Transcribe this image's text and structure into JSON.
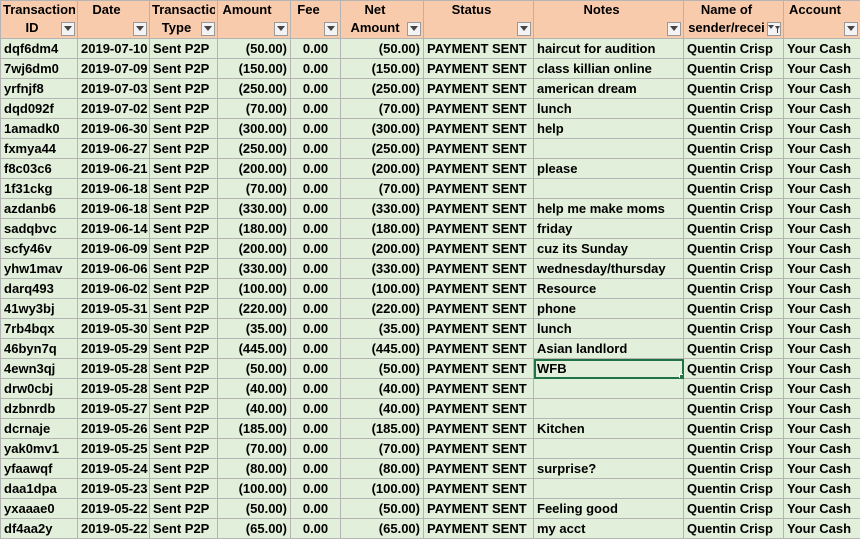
{
  "headers": [
    {
      "label": "Transaction ID",
      "filtered": false
    },
    {
      "label": "Date",
      "filtered": false
    },
    {
      "label": "Transaction Type",
      "filtered": false
    },
    {
      "label": "Amount",
      "filtered": false
    },
    {
      "label": "Fee",
      "filtered": false
    },
    {
      "label": "Net Amount",
      "filtered": false
    },
    {
      "label": "Status",
      "filtered": false
    },
    {
      "label": "Notes",
      "filtered": false
    },
    {
      "label": "Name of sender/recei",
      "filtered": true
    },
    {
      "label": "Account",
      "filtered": false
    }
  ],
  "rows": [
    [
      "dqf6dm4",
      "2019-07-10",
      "Sent P2P",
      "(50.00)",
      "0.00",
      "(50.00)",
      "PAYMENT SENT",
      "haircut for audition",
      "Quentin Crisp",
      "Your Cash"
    ],
    [
      "7wj6dm0",
      "2019-07-09",
      "Sent P2P",
      "(150.00)",
      "0.00",
      "(150.00)",
      "PAYMENT SENT",
      "class killian online",
      "Quentin Crisp",
      "Your Cash"
    ],
    [
      "yrfnjf8",
      "2019-07-03",
      "Sent P2P",
      "(250.00)",
      "0.00",
      "(250.00)",
      "PAYMENT SENT",
      "american dream",
      "Quentin Crisp",
      "Your Cash"
    ],
    [
      "dqd092f",
      "2019-07-02",
      "Sent P2P",
      "(70.00)",
      "0.00",
      "(70.00)",
      "PAYMENT SENT",
      "lunch",
      "Quentin Crisp",
      "Your Cash"
    ],
    [
      "1amadk0",
      "2019-06-30",
      "Sent P2P",
      "(300.00)",
      "0.00",
      "(300.00)",
      "PAYMENT SENT",
      "help",
      "Quentin Crisp",
      "Your Cash"
    ],
    [
      "fxmya44",
      "2019-06-27",
      "Sent P2P",
      "(250.00)",
      "0.00",
      "(250.00)",
      "PAYMENT SENT",
      "",
      "Quentin Crisp",
      "Your Cash"
    ],
    [
      "f8c03c6",
      "2019-06-21",
      "Sent P2P",
      "(200.00)",
      "0.00",
      "(200.00)",
      "PAYMENT SENT",
      "please",
      "Quentin Crisp",
      "Your Cash"
    ],
    [
      "1f31ckg",
      "2019-06-18",
      "Sent P2P",
      "(70.00)",
      "0.00",
      "(70.00)",
      "PAYMENT SENT",
      "",
      "Quentin Crisp",
      "Your Cash"
    ],
    [
      "azdanb6",
      "2019-06-18",
      "Sent P2P",
      "(330.00)",
      "0.00",
      "(330.00)",
      "PAYMENT SENT",
      "help me make moms",
      "Quentin Crisp",
      "Your Cash"
    ],
    [
      "sadqbvc",
      "2019-06-14",
      "Sent P2P",
      "(180.00)",
      "0.00",
      "(180.00)",
      "PAYMENT SENT",
      "friday",
      "Quentin Crisp",
      "Your Cash"
    ],
    [
      "scfy46v",
      "2019-06-09",
      "Sent P2P",
      "(200.00)",
      "0.00",
      "(200.00)",
      "PAYMENT SENT",
      "cuz its Sunday",
      "Quentin Crisp",
      "Your Cash"
    ],
    [
      "yhw1mav",
      "2019-06-06",
      "Sent P2P",
      "(330.00)",
      "0.00",
      "(330.00)",
      "PAYMENT SENT",
      "wednesday/thursday",
      "Quentin Crisp",
      "Your Cash"
    ],
    [
      "darq493",
      "2019-06-02",
      "Sent P2P",
      "(100.00)",
      "0.00",
      "(100.00)",
      "PAYMENT SENT",
      "Resource",
      "Quentin Crisp",
      "Your Cash"
    ],
    [
      "41wy3bj",
      "2019-05-31",
      "Sent P2P",
      "(220.00)",
      "0.00",
      "(220.00)",
      "PAYMENT SENT",
      "phone",
      "Quentin Crisp",
      "Your Cash"
    ],
    [
      "7rb4bqx",
      "2019-05-30",
      "Sent P2P",
      "(35.00)",
      "0.00",
      "(35.00)",
      "PAYMENT SENT",
      "lunch",
      "Quentin Crisp",
      "Your Cash"
    ],
    [
      "46byn7q",
      "2019-05-29",
      "Sent P2P",
      "(445.00)",
      "0.00",
      "(445.00)",
      "PAYMENT SENT",
      "Asian landlord",
      "Quentin Crisp",
      "Your Cash"
    ],
    [
      "4ewn3qj",
      "2019-05-28",
      "Sent P2P",
      "(50.00)",
      "0.00",
      "(50.00)",
      "PAYMENT SENT",
      "WFB",
      "Quentin Crisp",
      "Your Cash"
    ],
    [
      "drw0cbj",
      "2019-05-28",
      "Sent P2P",
      "(40.00)",
      "0.00",
      "(40.00)",
      "PAYMENT SENT",
      "",
      "Quentin Crisp",
      "Your Cash"
    ],
    [
      "dzbnrdb",
      "2019-05-27",
      "Sent P2P",
      "(40.00)",
      "0.00",
      "(40.00)",
      "PAYMENT SENT",
      "",
      "Quentin Crisp",
      "Your Cash"
    ],
    [
      "dcrnaje",
      "2019-05-26",
      "Sent P2P",
      "(185.00)",
      "0.00",
      "(185.00)",
      "PAYMENT SENT",
      "Kitchen",
      "Quentin Crisp",
      "Your Cash"
    ],
    [
      "yak0mv1",
      "2019-05-25",
      "Sent P2P",
      "(70.00)",
      "0.00",
      "(70.00)",
      "PAYMENT SENT",
      "",
      "Quentin Crisp",
      "Your Cash"
    ],
    [
      "yfaawqf",
      "2019-05-24",
      "Sent P2P",
      "(80.00)",
      "0.00",
      "(80.00)",
      "PAYMENT SENT",
      "surprise?",
      "Quentin Crisp",
      "Your Cash"
    ],
    [
      "daa1dpa",
      "2019-05-23",
      "Sent P2P",
      "(100.00)",
      "0.00",
      "(100.00)",
      "PAYMENT SENT",
      "",
      "Quentin Crisp",
      "Your Cash"
    ],
    [
      "yxaaae0",
      "2019-05-22",
      "Sent P2P",
      "(50.00)",
      "0.00",
      "(50.00)",
      "PAYMENT SENT",
      "Feeling good",
      "Quentin Crisp",
      "Your Cash"
    ],
    [
      "df4aa2y",
      "2019-05-22",
      "Sent P2P",
      "(65.00)",
      "0.00",
      "(65.00)",
      "PAYMENT SENT",
      "my acct",
      "Quentin Crisp",
      "Your Cash"
    ]
  ],
  "selected_cell": {
    "row": 16,
    "col": 7
  },
  "colors": {
    "header_bg": "#f8cbad",
    "cell_bg": "#e2efda",
    "grid": "#b4b4b4",
    "selection": "#217346"
  }
}
